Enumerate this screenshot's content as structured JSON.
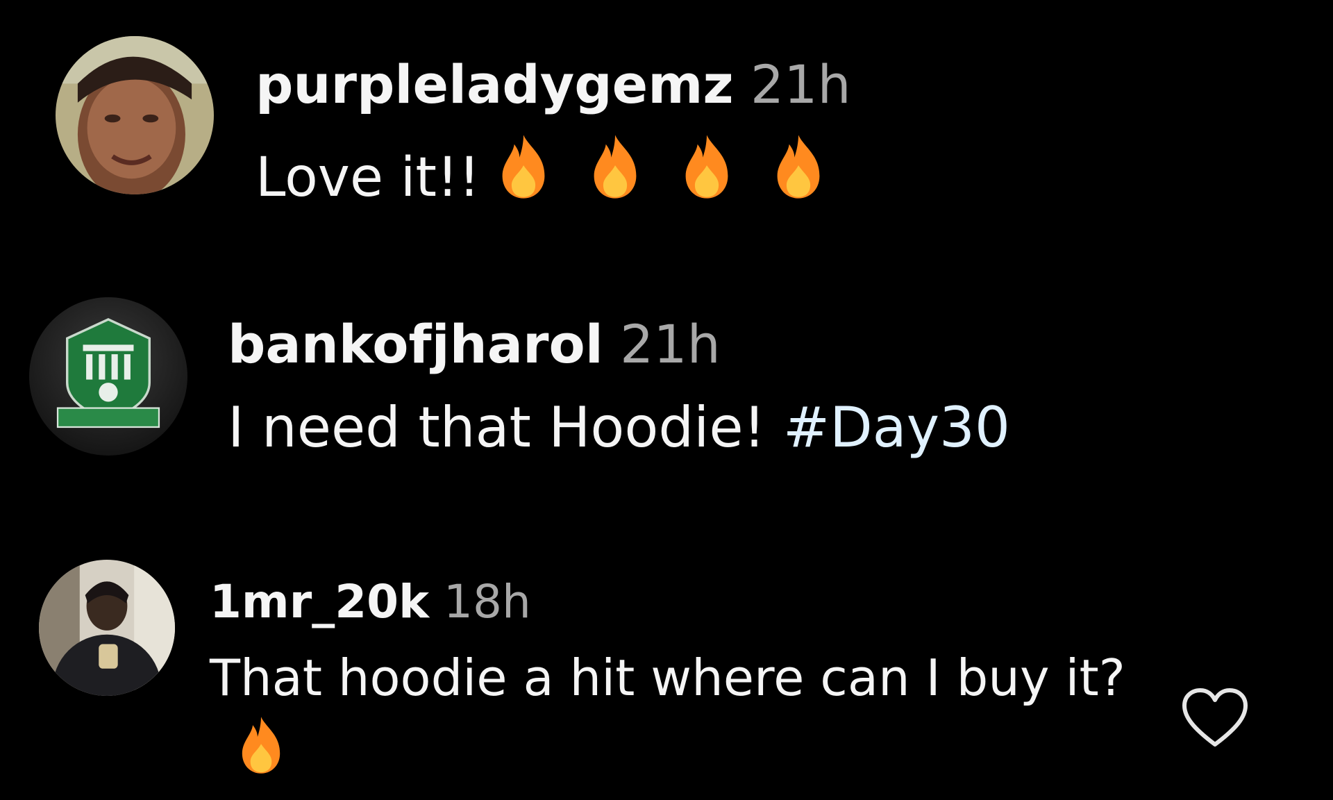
{
  "comments": [
    {
      "username": "purpleladygemz",
      "time": "21h",
      "text": "Love it!!",
      "emoji": [
        "fire-icon",
        "fire-icon",
        "fire-icon",
        "fire-icon"
      ]
    },
    {
      "username": "bankofjharol",
      "time": "21h",
      "text": "I need that Hoodie!",
      "hashtag": "#Day30"
    },
    {
      "username": "1mr_20k",
      "time": "18h",
      "text": "That hoodie a hit where can I buy it?",
      "emoji": [
        "fire-icon"
      ]
    }
  ],
  "colors": {
    "background": "#000000",
    "text": "#f5f5f5",
    "timestamp": "#a8a8a8",
    "hashtag": "#e0f1ff",
    "fire_outer": "#ff8a1f",
    "fire_inner": "#ffc640"
  },
  "icons": {
    "like": "heart-outline-icon",
    "emoji": "fire-icon"
  }
}
